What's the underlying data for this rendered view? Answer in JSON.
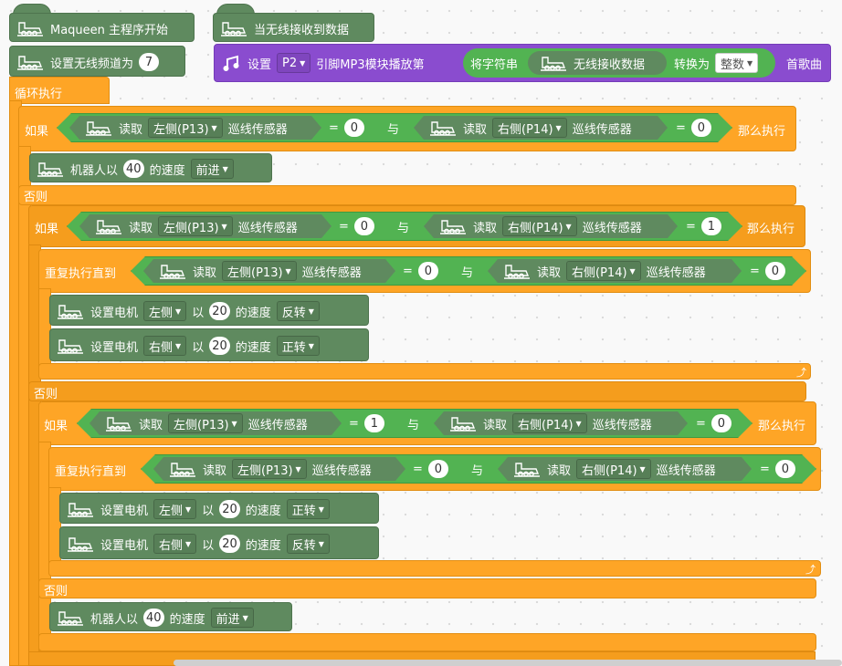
{
  "colors": {
    "block_green": "#5f8a5f",
    "logic_green": "#52b352",
    "control_orange": "#fea526",
    "mp3_purple": "#8a4ccf",
    "background": "#f9f9f9"
  },
  "icons": {
    "robot": "maqueen-robot-icon",
    "music": "music-notes-icon",
    "dropdown": "triangle-down",
    "loop": "loop-arrow-icon"
  },
  "start_block": {
    "label": "Maqueen 主程序开始"
  },
  "set_channel": {
    "label": "设置无线频道为",
    "value": "7"
  },
  "loop": {
    "label": "循环执行"
  },
  "radio_hat": {
    "label": "当无线接收到数据"
  },
  "mp3": {
    "set": "设置",
    "pin": "P2",
    "text": "引脚MP3模块播放第",
    "convert": "将字符串",
    "radio_data": "无线接收数据",
    "to": "转换为",
    "type": "整数",
    "suffix": "首歌曲"
  },
  "ifs": {
    "if": "如果",
    "then": "那么执行",
    "else": "否则",
    "repeat_until": "重复执行直到",
    "and": "与",
    "eq": "="
  },
  "sensor": {
    "read": "读取",
    "left": "左侧(P13)",
    "right": "右侧(P14)",
    "sensor": "巡线传感器"
  },
  "vals": {
    "zero": "0",
    "one": "1"
  },
  "robot_move": {
    "label": "机器人以",
    "speed": "40",
    "speed_suffix": "的速度",
    "direction": "前进"
  },
  "motor": {
    "label": "设置电机",
    "left": "左侧",
    "right": "右侧",
    "with": "以",
    "speed": "20",
    "speed_suffix": "的速度",
    "forward": "正转",
    "reverse": "反转"
  }
}
